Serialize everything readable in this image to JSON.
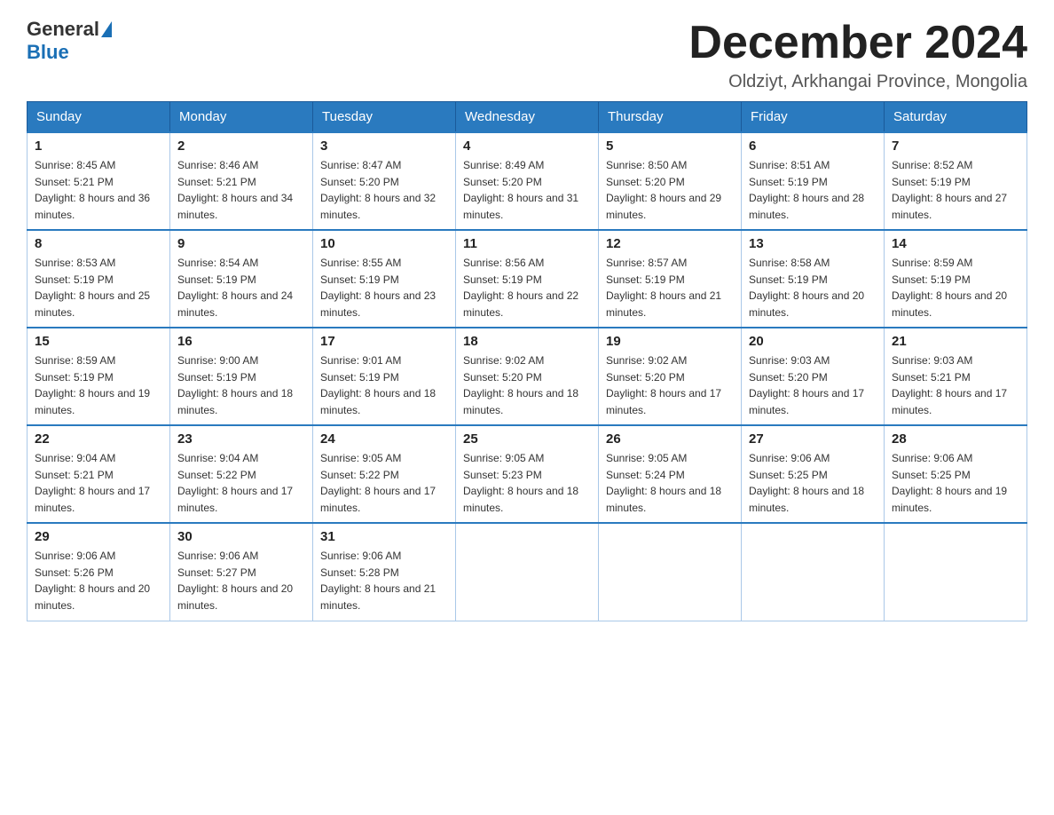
{
  "header": {
    "logo_general": "General",
    "logo_blue": "Blue",
    "month_title": "December 2024",
    "location": "Oldziyt, Arkhangai Province, Mongolia"
  },
  "weekdays": [
    "Sunday",
    "Monday",
    "Tuesday",
    "Wednesday",
    "Thursday",
    "Friday",
    "Saturday"
  ],
  "weeks": [
    [
      {
        "day": "1",
        "sunrise": "8:45 AM",
        "sunset": "5:21 PM",
        "daylight": "8 hours and 36 minutes."
      },
      {
        "day": "2",
        "sunrise": "8:46 AM",
        "sunset": "5:21 PM",
        "daylight": "8 hours and 34 minutes."
      },
      {
        "day": "3",
        "sunrise": "8:47 AM",
        "sunset": "5:20 PM",
        "daylight": "8 hours and 32 minutes."
      },
      {
        "day": "4",
        "sunrise": "8:49 AM",
        "sunset": "5:20 PM",
        "daylight": "8 hours and 31 minutes."
      },
      {
        "day": "5",
        "sunrise": "8:50 AM",
        "sunset": "5:20 PM",
        "daylight": "8 hours and 29 minutes."
      },
      {
        "day": "6",
        "sunrise": "8:51 AM",
        "sunset": "5:19 PM",
        "daylight": "8 hours and 28 minutes."
      },
      {
        "day": "7",
        "sunrise": "8:52 AM",
        "sunset": "5:19 PM",
        "daylight": "8 hours and 27 minutes."
      }
    ],
    [
      {
        "day": "8",
        "sunrise": "8:53 AM",
        "sunset": "5:19 PM",
        "daylight": "8 hours and 25 minutes."
      },
      {
        "day": "9",
        "sunrise": "8:54 AM",
        "sunset": "5:19 PM",
        "daylight": "8 hours and 24 minutes."
      },
      {
        "day": "10",
        "sunrise": "8:55 AM",
        "sunset": "5:19 PM",
        "daylight": "8 hours and 23 minutes."
      },
      {
        "day": "11",
        "sunrise": "8:56 AM",
        "sunset": "5:19 PM",
        "daylight": "8 hours and 22 minutes."
      },
      {
        "day": "12",
        "sunrise": "8:57 AM",
        "sunset": "5:19 PM",
        "daylight": "8 hours and 21 minutes."
      },
      {
        "day": "13",
        "sunrise": "8:58 AM",
        "sunset": "5:19 PM",
        "daylight": "8 hours and 20 minutes."
      },
      {
        "day": "14",
        "sunrise": "8:59 AM",
        "sunset": "5:19 PM",
        "daylight": "8 hours and 20 minutes."
      }
    ],
    [
      {
        "day": "15",
        "sunrise": "8:59 AM",
        "sunset": "5:19 PM",
        "daylight": "8 hours and 19 minutes."
      },
      {
        "day": "16",
        "sunrise": "9:00 AM",
        "sunset": "5:19 PM",
        "daylight": "8 hours and 18 minutes."
      },
      {
        "day": "17",
        "sunrise": "9:01 AM",
        "sunset": "5:19 PM",
        "daylight": "8 hours and 18 minutes."
      },
      {
        "day": "18",
        "sunrise": "9:02 AM",
        "sunset": "5:20 PM",
        "daylight": "8 hours and 18 minutes."
      },
      {
        "day": "19",
        "sunrise": "9:02 AM",
        "sunset": "5:20 PM",
        "daylight": "8 hours and 17 minutes."
      },
      {
        "day": "20",
        "sunrise": "9:03 AM",
        "sunset": "5:20 PM",
        "daylight": "8 hours and 17 minutes."
      },
      {
        "day": "21",
        "sunrise": "9:03 AM",
        "sunset": "5:21 PM",
        "daylight": "8 hours and 17 minutes."
      }
    ],
    [
      {
        "day": "22",
        "sunrise": "9:04 AM",
        "sunset": "5:21 PM",
        "daylight": "8 hours and 17 minutes."
      },
      {
        "day": "23",
        "sunrise": "9:04 AM",
        "sunset": "5:22 PM",
        "daylight": "8 hours and 17 minutes."
      },
      {
        "day": "24",
        "sunrise": "9:05 AM",
        "sunset": "5:22 PM",
        "daylight": "8 hours and 17 minutes."
      },
      {
        "day": "25",
        "sunrise": "9:05 AM",
        "sunset": "5:23 PM",
        "daylight": "8 hours and 18 minutes."
      },
      {
        "day": "26",
        "sunrise": "9:05 AM",
        "sunset": "5:24 PM",
        "daylight": "8 hours and 18 minutes."
      },
      {
        "day": "27",
        "sunrise": "9:06 AM",
        "sunset": "5:25 PM",
        "daylight": "8 hours and 18 minutes."
      },
      {
        "day": "28",
        "sunrise": "9:06 AM",
        "sunset": "5:25 PM",
        "daylight": "8 hours and 19 minutes."
      }
    ],
    [
      {
        "day": "29",
        "sunrise": "9:06 AM",
        "sunset": "5:26 PM",
        "daylight": "8 hours and 20 minutes."
      },
      {
        "day": "30",
        "sunrise": "9:06 AM",
        "sunset": "5:27 PM",
        "daylight": "8 hours and 20 minutes."
      },
      {
        "day": "31",
        "sunrise": "9:06 AM",
        "sunset": "5:28 PM",
        "daylight": "8 hours and 21 minutes."
      },
      null,
      null,
      null,
      null
    ]
  ]
}
